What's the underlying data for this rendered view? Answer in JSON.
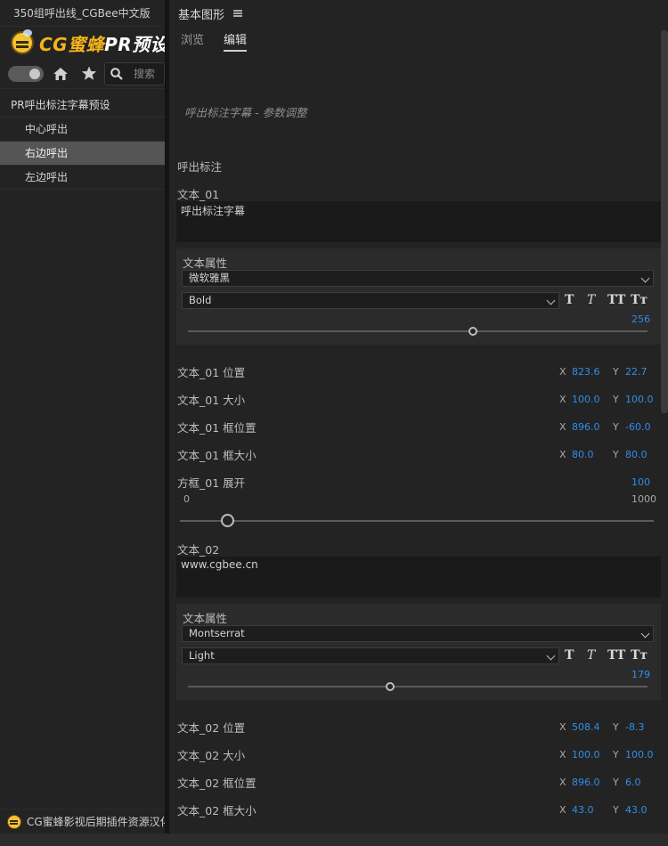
{
  "left_panel": {
    "title": "350组呼出线_CGBee中文版",
    "brand_cg": "CG蜜蜂",
    "brand_pr": "PR预设库",
    "search_placeholder": "搜索",
    "tree": {
      "header": "PR呼出标注字幕预设",
      "items": [
        {
          "label": "中心呼出",
          "selected": false
        },
        {
          "label": "右边呼出",
          "selected": true
        },
        {
          "label": "左边呼出",
          "selected": false
        }
      ]
    },
    "footer": "CG蜜蜂影视后期插件资源汉化"
  },
  "right_panel": {
    "title": "基本图形",
    "tabs": [
      {
        "label": "浏览",
        "active": false
      },
      {
        "label": "编辑",
        "active": true
      }
    ],
    "description": "呼出标注字幕 - 参数调整",
    "section_title": "呼出标注",
    "text1": {
      "label": "文本_01",
      "value": "呼出标注字幕",
      "props_title": "文本属性",
      "font": "微软雅黑",
      "style": "Bold",
      "size": "256",
      "size_fraction": 0.62
    },
    "params1": [
      {
        "label": "文本_01 位置",
        "x": "823.6",
        "y": "22.7"
      },
      {
        "label": "文本_01 大小",
        "x": "100.0",
        "y": "100.0"
      },
      {
        "label": "文本_01 框位置",
        "x": "896.0",
        "y": "-60.0"
      },
      {
        "label": "文本_01 框大小",
        "x": "80.0",
        "y": "80.0"
      }
    ],
    "expand": {
      "label": "方框_01 展开",
      "value": "100",
      "min": "0",
      "max": "1000",
      "fraction": 0.1
    },
    "text2": {
      "label": "文本_02",
      "value": "www.cgbee.cn",
      "props_title": "文本属性",
      "font": "Montserrat",
      "style": "Light",
      "size": "179",
      "size_fraction": 0.44
    },
    "params2": [
      {
        "label": "文本_02 位置",
        "x": "508.4",
        "y": "-8.3"
      },
      {
        "label": "文本_02 大小",
        "x": "100.0",
        "y": "100.0"
      },
      {
        "label": "文本_02 框位置",
        "x": "896.0",
        "y": "6.0"
      },
      {
        "label": "文本_02 框大小",
        "x": "43.0",
        "y": "43.0"
      }
    ],
    "xy": {
      "x": "X",
      "y": "Y"
    },
    "text_style_buttons": [
      "T",
      "T",
      "TT",
      "Tт"
    ]
  },
  "colors": {
    "accent_blue": "#2f8ee8",
    "brand_orange": "#f6b31a",
    "selected_row": "#555555"
  }
}
